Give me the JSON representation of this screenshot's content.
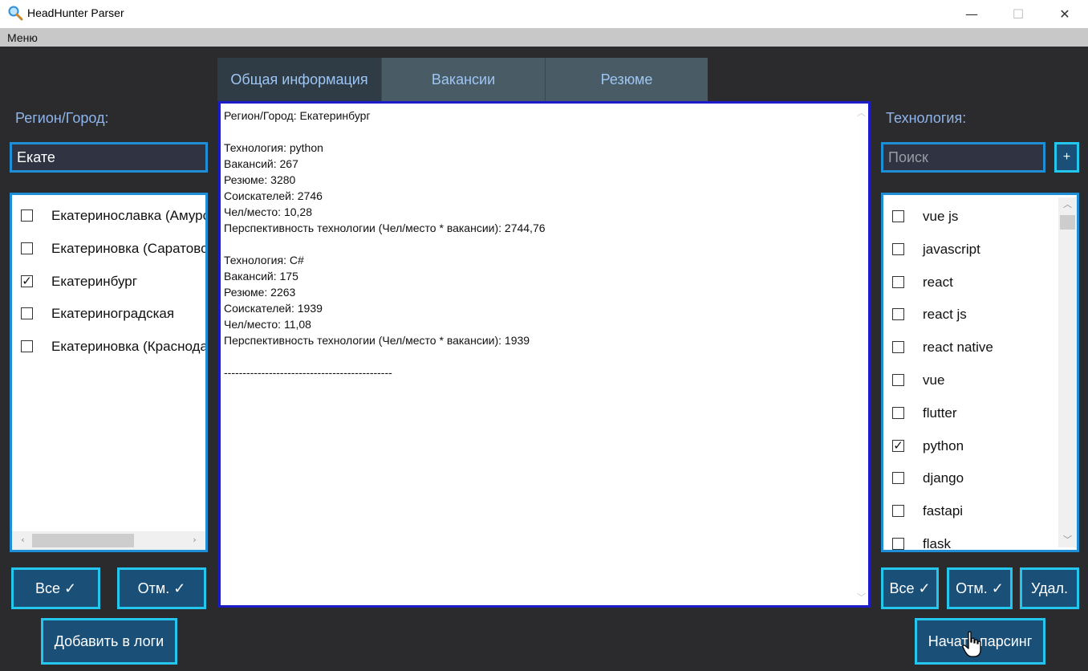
{
  "window": {
    "title": "HeadHunter Parser",
    "minimize": "—",
    "maximize": "☐",
    "close": "✕"
  },
  "menu": {
    "label": "Меню"
  },
  "left": {
    "region_label": "Регион/Город:",
    "region_value": "Екате",
    "items": [
      {
        "label": "Екатеринославка (Амурская область)",
        "checked": false
      },
      {
        "label": "Екатериновка (Саратовская область)",
        "checked": false
      },
      {
        "label": "Екатеринбург",
        "checked": true
      },
      {
        "label": "Екатериноградская",
        "checked": false
      },
      {
        "label": "Екатериновка (Краснодарский край)",
        "checked": false
      }
    ],
    "select_all": "Все ✓",
    "deselect_all": "Отм. ✓",
    "add_to_log": "Добавить в логи"
  },
  "tabs": [
    {
      "label": "Общая информация",
      "active": true
    },
    {
      "label": "Вакансии",
      "active": false
    },
    {
      "label": "Резюме",
      "active": false
    }
  ],
  "log": {
    "text": "Регион/Город: Екатеринбург\n\nТехнология: python\nВакансий: 267\nРезюме: 3280\nСоискателей: 2746\nЧел/место: 10,28\nПерспективность технологии (Чел/место * вакансии): 2744,76\n\nТехнология: C#\nВакансий: 175\nРезюме: 2263\nСоискателей: 1939\nЧел/место: 11,08\nПерспективность технологии (Чел/место * вакансии): 1939\n\n---------------------------------------------"
  },
  "right": {
    "tech_label": "Технология:",
    "search_placeholder": "Поиск",
    "add_label": "+",
    "items": [
      {
        "label": "vue js",
        "checked": false
      },
      {
        "label": "javascript",
        "checked": false
      },
      {
        "label": "react",
        "checked": false
      },
      {
        "label": "react js",
        "checked": false
      },
      {
        "label": "react native",
        "checked": false
      },
      {
        "label": "vue",
        "checked": false
      },
      {
        "label": "flutter",
        "checked": false
      },
      {
        "label": "python",
        "checked": true
      },
      {
        "label": "django",
        "checked": false
      },
      {
        "label": "fastapi",
        "checked": false
      },
      {
        "label": "flask",
        "checked": false
      }
    ],
    "select_all": "Все ✓",
    "deselect_all": "Отм. ✓",
    "delete": "Удал.",
    "start_parsing": "Начать парсинг"
  },
  "colors": {
    "background": "#2b2b2d",
    "accent_border": "#1e8fd6",
    "button_bg": "#1a4f78",
    "button_border": "#25c6ee",
    "label": "#8fb5ea"
  }
}
